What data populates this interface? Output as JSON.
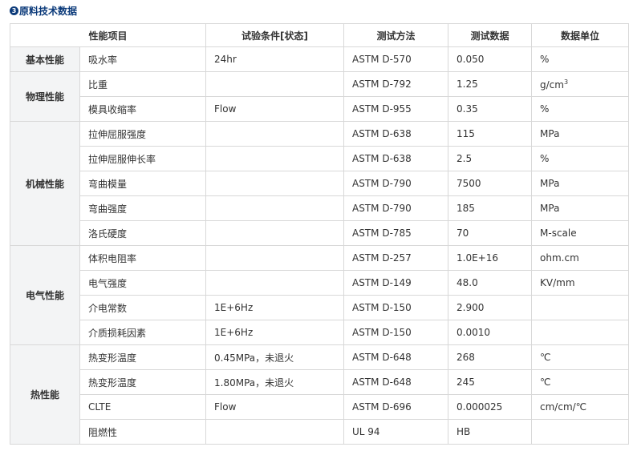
{
  "section_number": "3",
  "section_title": "原料技术数据",
  "columns": [
    "性能项目",
    "试验条件[状态]",
    "测试方法",
    "测试数据",
    "数据单位"
  ],
  "groups": [
    {
      "category": "基本性能",
      "rows": [
        {
          "property": "吸水率",
          "condition": "24hr",
          "method": "ASTM D-570",
          "value": "0.050",
          "unit": "%"
        }
      ]
    },
    {
      "category": "物理性能",
      "rows": [
        {
          "property": "比重",
          "condition": "",
          "method": "ASTM D-792",
          "value": "1.25",
          "unit": "g/cm",
          "unit_sup": "3"
        },
        {
          "property": "模具收缩率",
          "condition": "Flow",
          "method": "ASTM D-955",
          "value": "0.35",
          "unit": "%"
        }
      ]
    },
    {
      "category": "机械性能",
      "rows": [
        {
          "property": "拉伸屈服强度",
          "condition": "",
          "method": "ASTM D-638",
          "value": "115",
          "unit": "MPa"
        },
        {
          "property": "拉伸屈服伸长率",
          "condition": "",
          "method": "ASTM D-638",
          "value": "2.5",
          "unit": "%"
        },
        {
          "property": "弯曲模量",
          "condition": "",
          "method": "ASTM D-790",
          "value": "7500",
          "unit": "MPa"
        },
        {
          "property": "弯曲强度",
          "condition": "",
          "method": "ASTM D-790",
          "value": "185",
          "unit": "MPa"
        },
        {
          "property": "洛氏硬度",
          "condition": "",
          "method": "ASTM D-785",
          "value": "70",
          "unit": "M-scale"
        }
      ]
    },
    {
      "category": "电气性能",
      "rows": [
        {
          "property": "体积电阻率",
          "condition": "",
          "method": "ASTM D-257",
          "value": "1.0E+16",
          "unit": "ohm.cm"
        },
        {
          "property": "电气强度",
          "condition": "",
          "method": "ASTM D-149",
          "value": "48.0",
          "unit": "KV/mm"
        },
        {
          "property": "介电常数",
          "condition": "1E+6Hz",
          "method": "ASTM D-150",
          "value": "2.900",
          "unit": ""
        },
        {
          "property": "介质损耗因素",
          "condition": "1E+6Hz",
          "method": "ASTM D-150",
          "value": "0.0010",
          "unit": ""
        }
      ]
    },
    {
      "category": "热性能",
      "rows": [
        {
          "property": "热变形温度",
          "condition": "0.45MPa，未退火",
          "method": "ASTM D-648",
          "value": "268",
          "unit": "℃"
        },
        {
          "property": "热变形温度",
          "condition": "1.80MPa，未退火",
          "method": "ASTM D-648",
          "value": "245",
          "unit": "℃"
        },
        {
          "property": "CLTE",
          "condition": "Flow",
          "method": "ASTM D-696",
          "value": "0.000025",
          "unit": "cm/cm/℃"
        },
        {
          "property": "阻燃性",
          "condition": "",
          "method": "UL 94",
          "value": "HB",
          "unit": ""
        }
      ]
    }
  ]
}
